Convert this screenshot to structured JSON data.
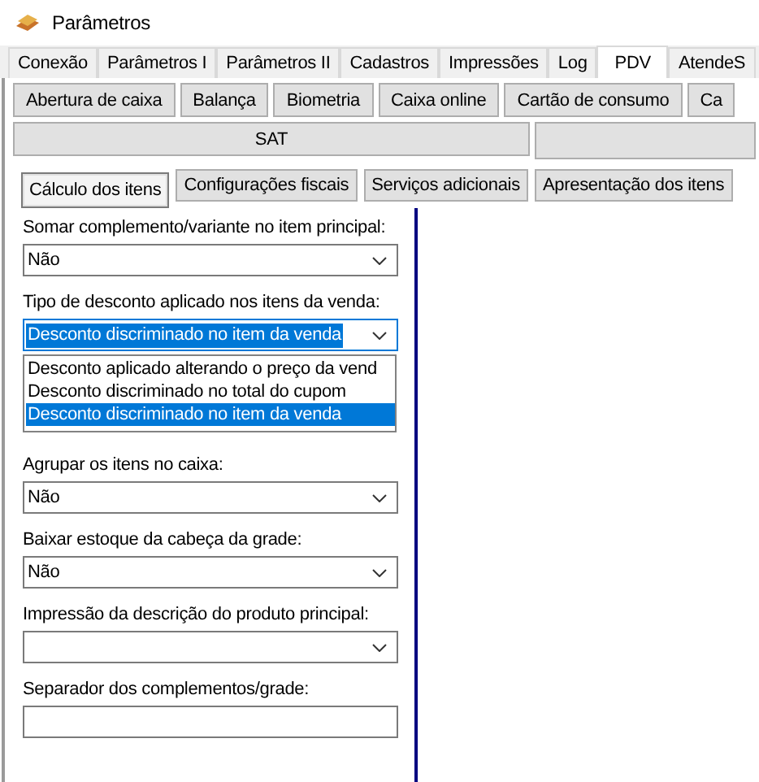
{
  "window": {
    "title": "Parâmetros"
  },
  "tabs": [
    {
      "label": "Conexão",
      "selected": false
    },
    {
      "label": "Parâmetros I",
      "selected": false
    },
    {
      "label": "Parâmetros II",
      "selected": false
    },
    {
      "label": "Cadastros",
      "selected": false
    },
    {
      "label": "Impressões",
      "selected": false
    },
    {
      "label": "Log",
      "selected": false
    },
    {
      "label": "PDV",
      "selected": true
    },
    {
      "label": "AtendeS",
      "selected": false
    }
  ],
  "section_buttons": [
    "Abertura de caixa",
    "Balança",
    "Biometria",
    "Caixa online",
    "Cartão de consumo",
    "Ca"
  ],
  "section_buttons_row2": [
    "SAT"
  ],
  "subtabs": [
    {
      "label": "Cálculo dos itens",
      "selected": true
    },
    {
      "label": "Configurações fiscais",
      "selected": false
    },
    {
      "label": "Serviços adicionais",
      "selected": false
    },
    {
      "label": "Apresentação dos itens",
      "selected": false
    }
  ],
  "fields": [
    {
      "kind": "select",
      "label": "Somar complemento/variante no item principal:",
      "value": "Não",
      "open": false
    },
    {
      "kind": "select",
      "label": "Tipo de desconto aplicado nos itens da venda:",
      "value": "Desconto discriminado no item da venda",
      "open": true,
      "options": [
        {
          "label": "Desconto aplicado alterando o preço da vend",
          "selected": false
        },
        {
          "label": "Desconto discriminado no total do cupom",
          "selected": false
        },
        {
          "label": "Desconto discriminado no item da venda",
          "selected": true
        }
      ]
    },
    {
      "kind": "select",
      "label": "Agrupar os itens no caixa:",
      "value": "Não",
      "open": false
    },
    {
      "kind": "select",
      "label": "Baixar estoque da cabeça da grade:",
      "value": "Não",
      "open": false
    },
    {
      "kind": "select",
      "label": "Impressão da descrição do produto principal:",
      "open": false
    },
    {
      "kind": "text",
      "label": "Separador dos complementos/grade:"
    }
  ]
}
